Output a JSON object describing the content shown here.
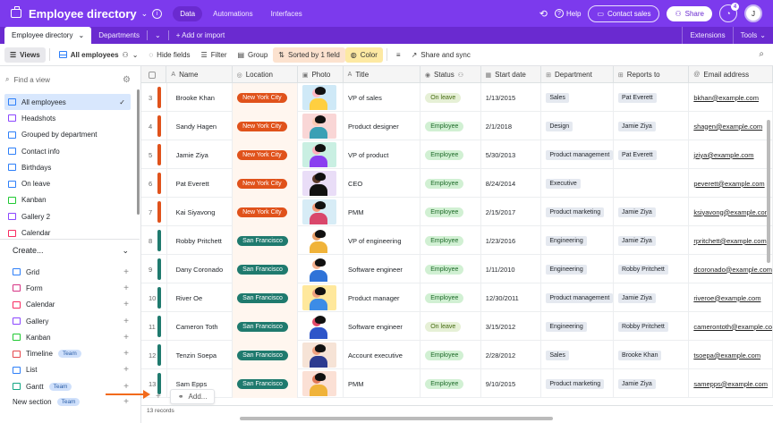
{
  "app": {
    "title": "Employee directory",
    "nav_tabs": [
      "Data",
      "Automations",
      "Interfaces"
    ],
    "help_label": "Help",
    "contact_sales_label": "Contact sales",
    "share_label": "Share",
    "notification_count": "4",
    "user_initial": "J"
  },
  "tables": {
    "active": "Employee directory",
    "other": "Departments",
    "add_label": "+ Add or import",
    "extensions_label": "Extensions",
    "tools_label": "Tools"
  },
  "toolbar": {
    "views_label": "Views",
    "view_name": "All employees",
    "hide_fields": "Hide fields",
    "filter": "Filter",
    "group": "Group",
    "sorted": "Sorted by 1 field",
    "color": "Color",
    "share_sync": "Share and sync"
  },
  "sidebar": {
    "find_placeholder": "Find a view",
    "views": [
      {
        "label": "All employees",
        "color": "#2d7ff9"
      },
      {
        "label": "Headshots",
        "color": "#8b46ff"
      },
      {
        "label": "Grouped by department",
        "color": "#2d7ff9"
      },
      {
        "label": "Contact info",
        "color": "#2d7ff9"
      },
      {
        "label": "Birthdays",
        "color": "#2d7ff9"
      },
      {
        "label": "On leave",
        "color": "#2d7ff9"
      },
      {
        "label": "Kanban",
        "color": "#20c933"
      },
      {
        "label": "Gallery 2",
        "color": "#8b46ff"
      },
      {
        "label": "Calendar",
        "color": "#f82b60"
      }
    ],
    "create_label": "Create...",
    "create_items": [
      {
        "label": "Grid",
        "color": "#2d7ff9",
        "team": ""
      },
      {
        "label": "Form",
        "color": "#d63384",
        "team": ""
      },
      {
        "label": "Calendar",
        "color": "#f82b60",
        "team": ""
      },
      {
        "label": "Gallery",
        "color": "#8b46ff",
        "team": ""
      },
      {
        "label": "Kanban",
        "color": "#20c933",
        "team": ""
      },
      {
        "label": "Timeline",
        "color": "#e5484d",
        "team": "Team"
      },
      {
        "label": "List",
        "color": "#2d7ff9",
        "team": ""
      },
      {
        "label": "Gantt",
        "color": "#11a683",
        "team": "Team"
      }
    ],
    "new_section_label": "New section",
    "new_section_team": "Team"
  },
  "grid": {
    "columns": [
      "Name",
      "Location",
      "Photo",
      "Title",
      "Status",
      "Start date",
      "Department",
      "Reports to",
      "Email address"
    ],
    "rows": [
      {
        "num": "3",
        "bar": "#e0521b",
        "name": "Brooke Khan",
        "loc": "New York City",
        "locColor": "#e0521b",
        "title": "VP of sales",
        "status": "On leave",
        "start": "1/13/2015",
        "dept": "Sales",
        "reports": "Pat Everett",
        "email": "bkhan@example.com",
        "photoBg": "#cfe9f7",
        "skin": "#ffb9c6",
        "body": "#ffcf40"
      },
      {
        "num": "4",
        "bar": "#e0521b",
        "name": "Sandy Hagen",
        "loc": "New York City",
        "locColor": "#e0521b",
        "title": "Product designer",
        "status": "Employee",
        "start": "2/1/2018",
        "dept": "Design",
        "reports": "Jamie Ziya",
        "email": "shagen@example.com",
        "photoBg": "#f9d6d6",
        "skin": "#fbc9b2",
        "body": "#3aa0b5"
      },
      {
        "num": "5",
        "bar": "#e0521b",
        "name": "Jamie Ziya",
        "loc": "New York City",
        "locColor": "#e0521b",
        "title": "VP of product",
        "status": "Employee",
        "start": "5/30/2013",
        "dept": "Product management",
        "reports": "Pat Everett",
        "email": "jziya@example.com",
        "photoBg": "#c9efe2",
        "skin": "#ffb0bd",
        "body": "#8a3ff0"
      },
      {
        "num": "6",
        "bar": "#e0521b",
        "name": "Pat Everett",
        "loc": "New York City",
        "locColor": "#e0521b",
        "title": "CEO",
        "status": "Employee",
        "start": "8/24/2014",
        "dept": "Executive",
        "reports": "",
        "email": "peverett@example.com",
        "photoBg": "#e9ddf7",
        "skin": "#5b3a2a",
        "body": "#111111"
      },
      {
        "num": "7",
        "bar": "#e0521b",
        "name": "Kai Siyavong",
        "loc": "New York City",
        "locColor": "#e0521b",
        "title": "PMM",
        "status": "Employee",
        "start": "2/15/2017",
        "dept": "Product marketing",
        "reports": "Jamie Ziya",
        "email": "ksiyavong@example.com",
        "photoBg": "#d7ecf6",
        "skin": "#f59a78",
        "body": "#d9476b"
      },
      {
        "num": "8",
        "bar": "#1f7a6e",
        "name": "Robby Pritchett",
        "loc": "San Francisco",
        "locColor": "#1f7a6e",
        "title": "VP of engineering",
        "status": "Employee",
        "start": "1/23/2016",
        "dept": "Engineering",
        "reports": "Jamie Ziya",
        "email": "rpritchett@example.com",
        "photoBg": "#ffffff",
        "skin": "#e9a06a",
        "body": "#f0b33a"
      },
      {
        "num": "9",
        "bar": "#1f7a6e",
        "name": "Dany Coronado",
        "loc": "San Francisco",
        "locColor": "#1f7a6e",
        "title": "Software engineer",
        "status": "Employee",
        "start": "1/11/2010",
        "dept": "Engineering",
        "reports": "Robby Pritchett",
        "email": "dcoronado@example.com",
        "photoBg": "#ffffff",
        "skin": "#f3b08f",
        "body": "#2f73d8"
      },
      {
        "num": "10",
        "bar": "#1f7a6e",
        "name": "River Oe",
        "loc": "San Francisco",
        "locColor": "#1f7a6e",
        "title": "Product manager",
        "status": "Employee",
        "start": "12/30/2011",
        "dept": "Product management",
        "reports": "Jamie Ziya",
        "email": "riveroe@example.com",
        "photoBg": "#ffe89c",
        "skin": "#f0a17f",
        "body": "#3c8ce7"
      },
      {
        "num": "11",
        "bar": "#1f7a6e",
        "name": "Cameron Toth",
        "loc": "San Francisco",
        "locColor": "#1f7a6e",
        "title": "Software engineer",
        "status": "On leave",
        "start": "3/15/2012",
        "dept": "Engineering",
        "reports": "Robby Pritchett",
        "email": "camerontoth@example.com",
        "photoBg": "#ffffff",
        "skin": "#e34b6b",
        "body": "#2e55c9"
      },
      {
        "num": "12",
        "bar": "#1f7a6e",
        "name": "Tenzin Soepa",
        "loc": "San Francisco",
        "locColor": "#1f7a6e",
        "title": "Account executive",
        "status": "Employee",
        "start": "2/28/2012",
        "dept": "Sales",
        "reports": "Brooke Khan",
        "email": "tsoepa@example.com",
        "photoBg": "#f6e3d6",
        "skin": "#f0a17f",
        "body": "#2d3b8f"
      },
      {
        "num": "13",
        "bar": "#1f7a6e",
        "name": "Sam Epps",
        "loc": "San Francisco",
        "locColor": "#1f7a6e",
        "title": "PMM",
        "status": "Employee",
        "start": "9/10/2015",
        "dept": "Product marketing",
        "reports": "Jamie Ziya",
        "email": "samepps@example.com",
        "photoBg": "#fbe0d5",
        "skin": "#e07a5a",
        "body": "#f0b33a"
      }
    ],
    "add_label": "Add...",
    "footer": "13 records",
    "status_colors": {
      "On leave": "#e6f0d6",
      "Employee": "#d1f0d3"
    },
    "status_text_colors": {
      "On leave": "#456b12",
      "Employee": "#1f6b2a"
    }
  }
}
